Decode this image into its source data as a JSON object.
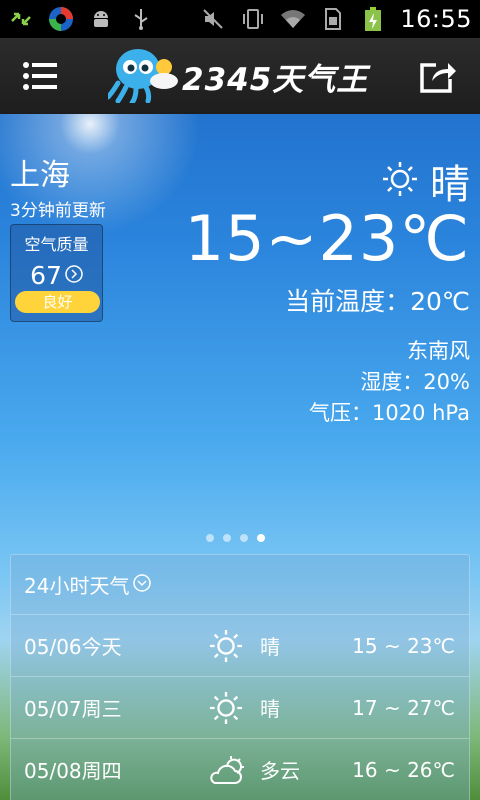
{
  "status_bar": {
    "time": "16:55",
    "left_icons": [
      "sync-icon",
      "app-icon",
      "android-debug-icon",
      "usb-icon"
    ],
    "right_icons": [
      "mute-icon",
      "vibrate-icon",
      "wifi-icon",
      "sim-icon",
      "battery-charging-icon"
    ]
  },
  "app_bar": {
    "logo_text": "2345天气王",
    "menu_icon": "menu-icon",
    "share_icon": "share-icon"
  },
  "weather": {
    "city": "上海",
    "updated": "3分钟前更新",
    "aqi": {
      "title": "空气质量",
      "value": "67",
      "level": "良好",
      "level_color": "#ffd43b"
    },
    "condition": "晴",
    "temp_range": "15~23℃",
    "current": "当前温度：20℃",
    "wind": "东南风",
    "humidity": "湿度：20%",
    "pressure": "气压：1020 hPa"
  },
  "pager": {
    "count": 4,
    "active": 4
  },
  "forecast": {
    "title": "24小时天气",
    "rows": [
      {
        "date": "05/06今天",
        "icon": "sunny-icon",
        "text": "晴",
        "range": "15 ~ 23℃"
      },
      {
        "date": "05/07周三",
        "icon": "sunny-icon",
        "text": "晴",
        "range": "17 ~ 27℃"
      },
      {
        "date": "05/08周四",
        "icon": "partly-cloudy-icon",
        "text": "多云",
        "range": "16 ~ 26℃"
      }
    ]
  }
}
